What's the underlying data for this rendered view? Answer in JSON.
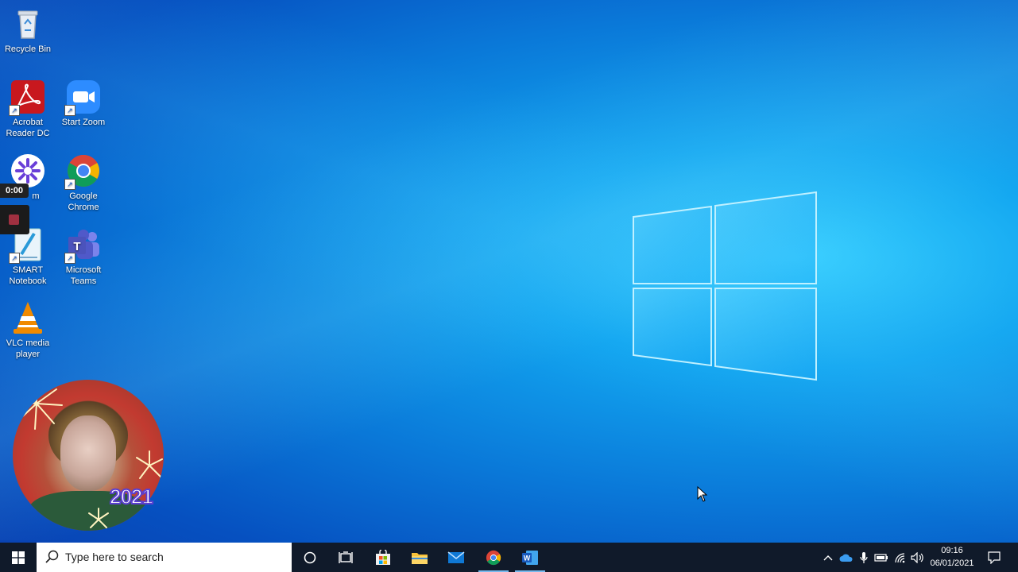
{
  "desktop": {
    "icons": [
      {
        "label": "Recycle Bin",
        "icon": "recycle-bin-icon"
      },
      {
        "label": "Acrobat Reader DC",
        "icon": "acrobat-icon"
      },
      {
        "label": "Start Zoom",
        "icon": "zoom-icon"
      },
      {
        "label": "m",
        "icon": "screencast-icon"
      },
      {
        "label": "Google Chrome",
        "icon": "chrome-icon"
      },
      {
        "label": "SMART Notebook",
        "icon": "smart-notebook-icon"
      },
      {
        "label": "Microsoft Teams",
        "icon": "teams-icon"
      },
      {
        "label": "VLC media player",
        "icon": "vlc-icon"
      }
    ]
  },
  "recorder": {
    "time": "0:00"
  },
  "webcam": {
    "year_text": "2021"
  },
  "taskbar": {
    "search_placeholder": "Type here to search",
    "apps": [
      {
        "name": "Cortana",
        "icon": "cortana-icon"
      },
      {
        "name": "Task View",
        "icon": "task-view-icon"
      },
      {
        "name": "Microsoft Store",
        "icon": "store-icon"
      },
      {
        "name": "File Explorer",
        "icon": "folder-icon"
      },
      {
        "name": "Mail",
        "icon": "mail-icon"
      },
      {
        "name": "Google Chrome",
        "icon": "chrome-icon",
        "active": true
      },
      {
        "name": "Microsoft Word",
        "icon": "word-icon",
        "active": true
      }
    ],
    "clock": {
      "time": "09:16",
      "date": "06/01/2021"
    }
  },
  "colors": {
    "taskbar_bg": "#101a2a",
    "accent": "#76b9ed",
    "desktop_blue": "#0a78d8"
  }
}
